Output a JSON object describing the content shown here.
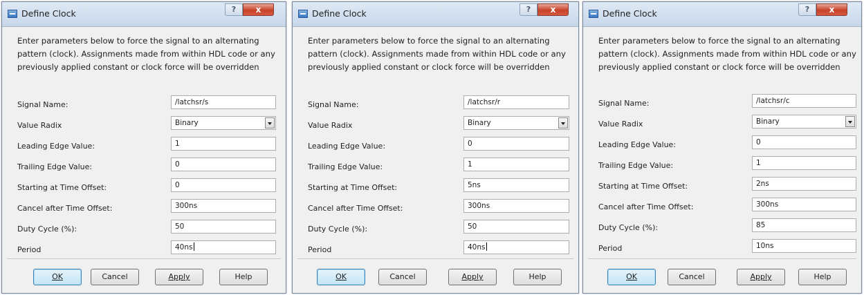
{
  "dialogs": [
    {
      "title": "Define Clock",
      "description": "Enter parameters below to force the signal to an alternating pattern (clock). Assignments made from within HDL code or any previously applied constant or clock force will be overridden",
      "fields": {
        "signal_name_label": "Signal Name:",
        "signal_name_value": "/latchsr/s",
        "value_radix_label": "Value Radix",
        "value_radix_value": "Binary",
        "leading_edge_label": "Leading Edge Value:",
        "leading_edge_value": "1",
        "trailing_edge_label": "Trailing Edge Value:",
        "trailing_edge_value": "0",
        "start_offset_label": "Starting at Time Offset:",
        "start_offset_value": "0",
        "cancel_offset_label": "Cancel after Time Offset:",
        "cancel_offset_value": "300ns",
        "duty_cycle_label": "Duty Cycle (%):",
        "duty_cycle_value": "50",
        "period_label": "Period",
        "period_value": "40ns"
      },
      "buttons": {
        "ok": "OK",
        "cancel": "Cancel",
        "apply": "Apply",
        "help": "Help"
      },
      "titlebar_buttons": {
        "help": "?",
        "close": "x"
      }
    },
    {
      "title": "Define Clock",
      "description": "Enter parameters below to force the signal to an alternating pattern (clock). Assignments made from within HDL code or any previously applied constant or clock force will be overridden",
      "fields": {
        "signal_name_label": "Signal Name:",
        "signal_name_value": "/latchsr/r",
        "value_radix_label": "Value Radix",
        "value_radix_value": "Binary",
        "leading_edge_label": "Leading Edge Value:",
        "leading_edge_value": "0",
        "trailing_edge_label": "Trailing Edge Value:",
        "trailing_edge_value": "1",
        "start_offset_label": "Starting at Time Offset:",
        "start_offset_value": "5ns",
        "cancel_offset_label": "Cancel after Time Offset:",
        "cancel_offset_value": "300ns",
        "duty_cycle_label": "Duty Cycle (%):",
        "duty_cycle_value": "50",
        "period_label": "Period",
        "period_value": "40ns"
      },
      "buttons": {
        "ok": "OK",
        "cancel": "Cancel",
        "apply": "Apply",
        "help": "Help"
      },
      "titlebar_buttons": {
        "help": "?",
        "close": "x"
      }
    },
    {
      "title": "Define Clock",
      "description": "Enter parameters below to force the signal to an alternating pattern (clock). Assignments made from within HDL code or any previously applied constant or clock force will be overridden",
      "fields": {
        "signal_name_label": "Signal Name:",
        "signal_name_value": "/latchsr/c",
        "value_radix_label": "Value Radix",
        "value_radix_value": "Binary",
        "leading_edge_label": "Leading Edge Value:",
        "leading_edge_value": "0",
        "trailing_edge_label": "Trailing Edge Value:",
        "trailing_edge_value": "1",
        "start_offset_label": "Starting at Time Offset:",
        "start_offset_value": "2ns",
        "cancel_offset_label": "Cancel after Time Offset:",
        "cancel_offset_value": "300ns",
        "duty_cycle_label": "Duty Cycle (%):",
        "duty_cycle_value": "85",
        "period_label": "Period",
        "period_value": "10ns"
      },
      "buttons": {
        "ok": "OK",
        "cancel": "Cancel",
        "apply": "Apply",
        "help": "Help"
      },
      "titlebar_buttons": {
        "help": "?",
        "close": "x"
      }
    }
  ],
  "icons": {
    "app": "define-clock-app-icon",
    "dropdown": "chevron-down-icon"
  }
}
